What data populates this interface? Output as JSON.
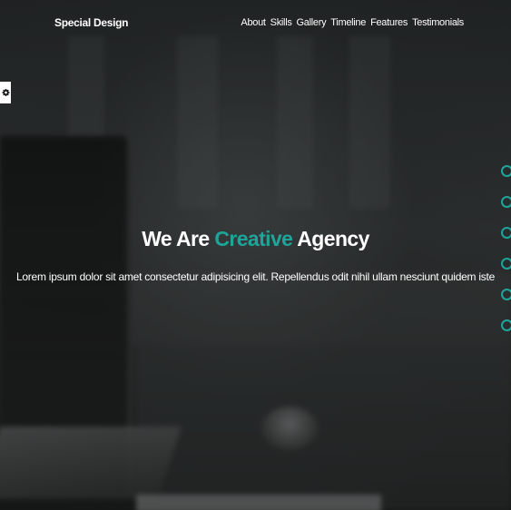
{
  "header": {
    "brand": "Special Design",
    "nav": [
      "About",
      "Skills",
      "Gallery",
      "Timeline",
      "Features",
      "Testimonials"
    ]
  },
  "settings": {
    "icon": "gear-icon"
  },
  "hero": {
    "title_before": "We Are ",
    "title_accent": "Creative",
    "title_after": " Agency",
    "text": "Lorem ipsum dolor sit amet consectetur adipisicing elit. Repellendus odit nihil ullam nesciunt quidem iste"
  },
  "bullets": {
    "count": 6
  },
  "colors": {
    "accent": "#1ea59a",
    "text": "#ffffff",
    "background": "#222525"
  }
}
